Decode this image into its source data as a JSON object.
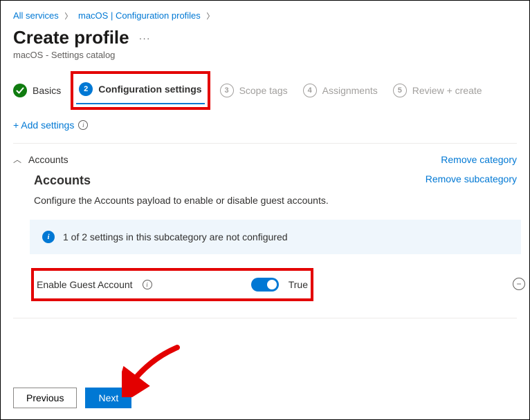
{
  "breadcrumb": {
    "items": [
      "All services",
      "macOS | Configuration profiles"
    ]
  },
  "page": {
    "title": "Create profile",
    "subtitle": "macOS - Settings catalog"
  },
  "steps": {
    "s1": "Basics",
    "s2_num": "2",
    "s2": "Configuration settings",
    "s3_num": "3",
    "s3": "Scope tags",
    "s4_num": "4",
    "s4": "Assignments",
    "s5_num": "5",
    "s5": "Review + create"
  },
  "actions": {
    "add_settings": "+ Add settings",
    "remove_category": "Remove category",
    "remove_subcategory": "Remove subcategory"
  },
  "category": {
    "name": "Accounts",
    "sub_title": "Accounts",
    "description": "Configure the Accounts payload to enable or disable guest accounts.",
    "notice": "1 of 2 settings in this subcategory are not configured"
  },
  "setting": {
    "label": "Enable Guest Account",
    "value_label": "True"
  },
  "footer": {
    "previous": "Previous",
    "next": "Next"
  }
}
